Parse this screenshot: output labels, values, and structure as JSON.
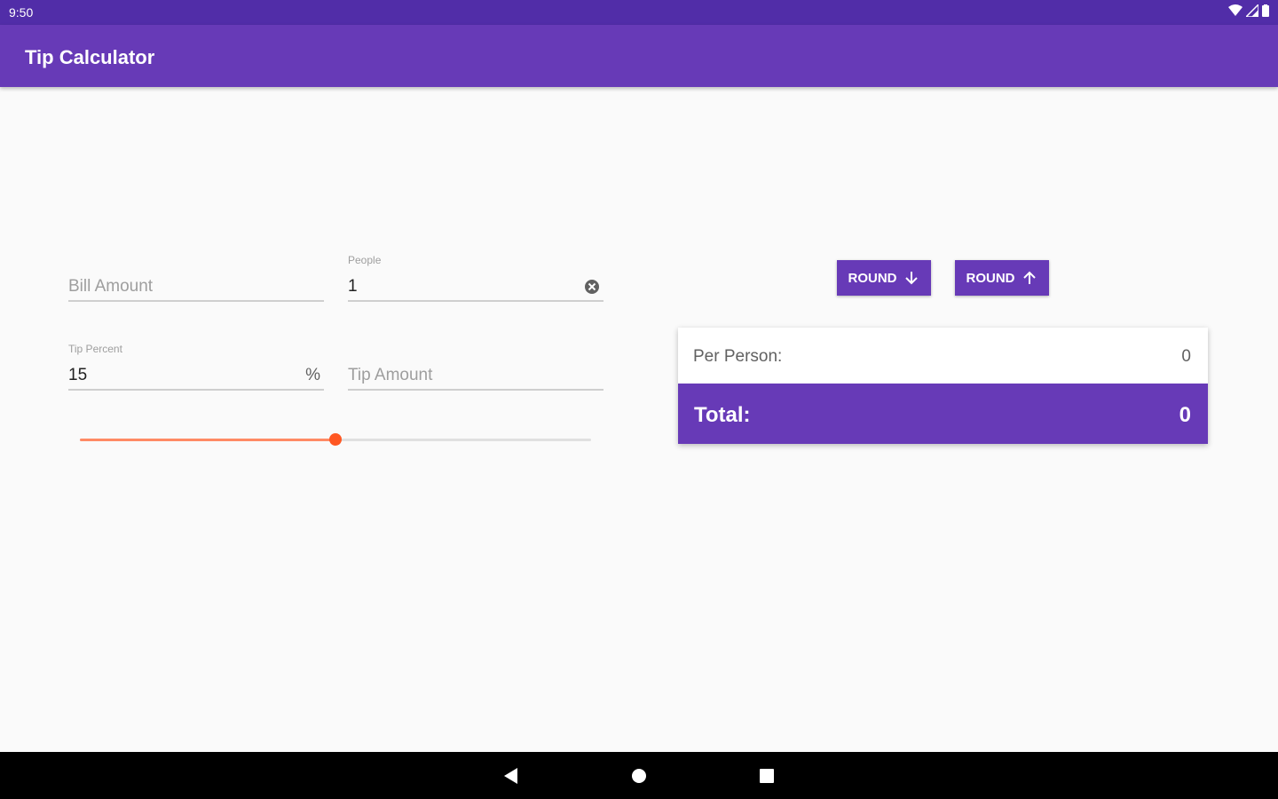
{
  "status_bar": {
    "time": "9:50",
    "icons": [
      "wifi-icon",
      "signal-icon",
      "battery-icon"
    ]
  },
  "app_bar": {
    "title": "Tip Calculator"
  },
  "form": {
    "bill_amount": {
      "placeholder": "Bill Amount",
      "value": ""
    },
    "people": {
      "label": "People",
      "value": "1",
      "clear_icon": "clear-icon"
    },
    "tip_percent": {
      "label": "Tip Percent",
      "value": "15",
      "suffix": "%"
    },
    "tip_amount": {
      "placeholder": "Tip Amount",
      "value": ""
    },
    "tip_slider": {
      "value": 0.5
    }
  },
  "round_buttons": {
    "down": {
      "label": "ROUND",
      "icon": "arrow-down-icon"
    },
    "up": {
      "label": "ROUND",
      "icon": "arrow-up-icon"
    }
  },
  "result": {
    "per_person_label": "Per Person:",
    "per_person_value": "0",
    "total_label": "Total:",
    "total_value": "0"
  },
  "nav_bar": {
    "icons": [
      "back-icon",
      "home-icon",
      "recents-icon"
    ]
  },
  "colors": {
    "primary": "#673ab7",
    "primary_dark": "#512da8",
    "accent": "#ff5722"
  }
}
